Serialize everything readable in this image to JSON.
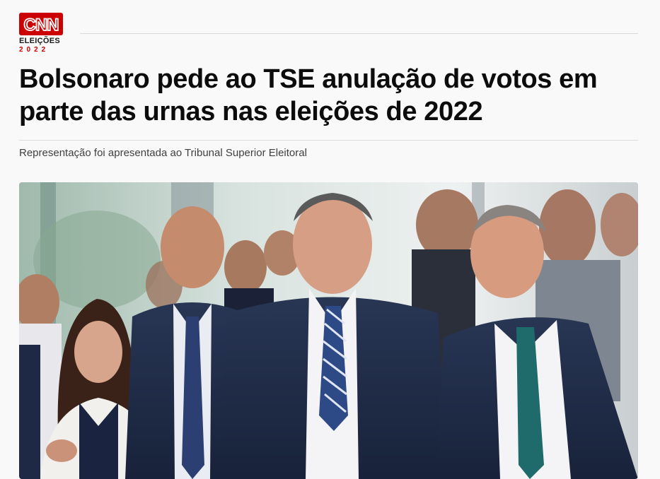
{
  "brand": {
    "name": "CNN",
    "section_line1": "ELEIÇÕES",
    "section_line2": "2022",
    "brand_color": "#cc0000"
  },
  "article": {
    "headline": "Bolsonaro pede ao TSE anulação de votos em parte das urnas nas eleições de 2022",
    "subtitle": "Representação foi apresentada ao Tribunal Superior Eleitoral"
  },
  "hero_image": {
    "kind": "news-photo"
  }
}
